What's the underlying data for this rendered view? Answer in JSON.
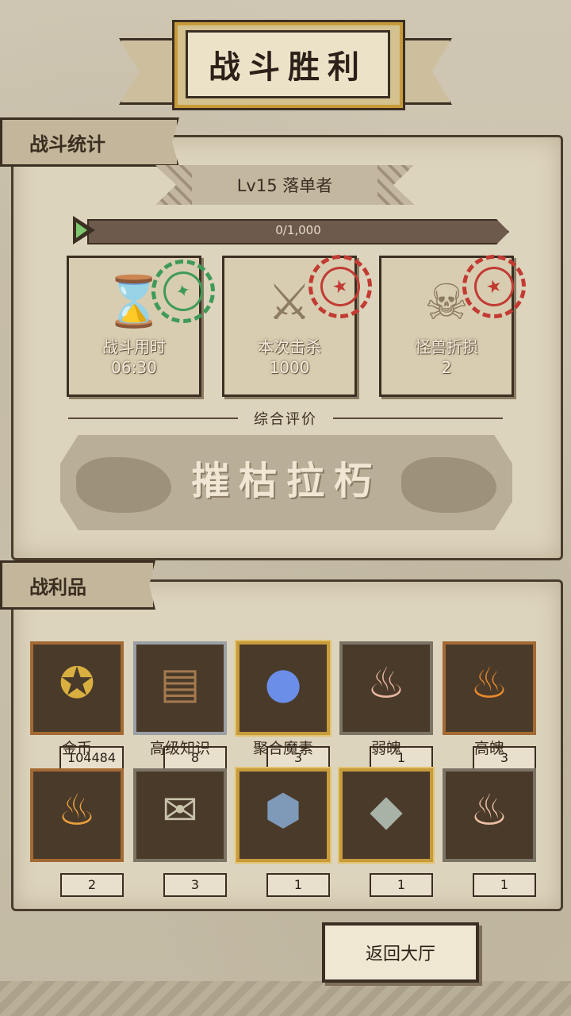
{
  "title": "战斗胜利",
  "stats_section": {
    "label": "战斗统计",
    "level_text": "Lv15 落单者",
    "xp_text": "0/1,000",
    "xp_progress": 0.0,
    "cards": [
      {
        "label": "战斗用时",
        "value": "06:30",
        "icon": "hourglass-icon",
        "stamp": "green"
      },
      {
        "label": "本次击杀",
        "value": "1000",
        "icon": "crossed-swords-icon",
        "stamp": "red"
      },
      {
        "label": "怪兽折损",
        "value": "2",
        "icon": "horned-skull-icon",
        "stamp": "red"
      }
    ],
    "rating_label": "综合评价",
    "rating_value": "摧枯拉朽"
  },
  "loot_section": {
    "label": "战利品",
    "items": [
      {
        "name": "金币",
        "count": "104484",
        "icon": "gold-coin-icon"
      },
      {
        "name": "高级知识",
        "count": "8",
        "icon": "book-icon"
      },
      {
        "name": "聚合魔素",
        "count": "3",
        "icon": "magic-orb-icon"
      },
      {
        "name": "弱魄",
        "count": "1",
        "icon": "pale-flame-icon"
      },
      {
        "name": "高魄",
        "count": "3",
        "icon": "fire-icon"
      },
      {
        "name": "",
        "count": "2",
        "icon": "flame-icon"
      },
      {
        "name": "",
        "count": "3",
        "icon": "scroll-icon"
      },
      {
        "name": "",
        "count": "1",
        "icon": "blue-ore-icon"
      },
      {
        "name": "",
        "count": "1",
        "icon": "crystal-ore-icon"
      },
      {
        "name": "",
        "count": "1",
        "icon": "small-flame-icon"
      }
    ]
  },
  "return_button": "返回大厅",
  "colors": {
    "parchment": "#ddd4bd",
    "ink": "#3b2e22",
    "gold": "#c79b3a",
    "stamp_green": "#3f9a58",
    "stamp_red": "#c23b33"
  }
}
